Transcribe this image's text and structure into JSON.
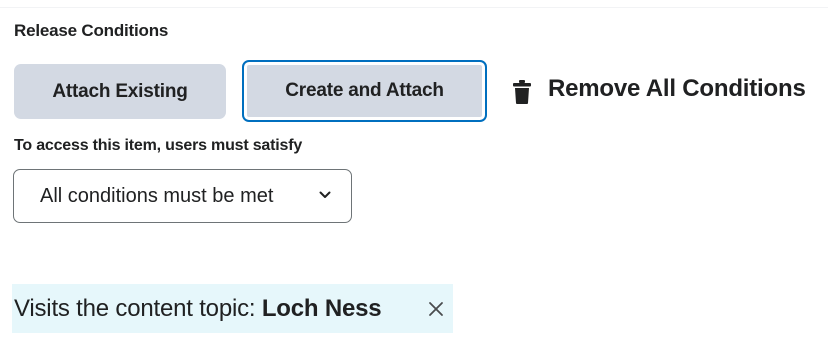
{
  "release_conditions": {
    "heading": "Release Conditions",
    "attach_existing_label": "Attach Existing",
    "create_and_attach_label": "Create and Attach",
    "remove_all_label": "Remove All Conditions",
    "access_label": "To access this item, users must satisfy",
    "criteria_select": {
      "selected_value": "All conditions must be met"
    },
    "conditions": [
      {
        "prefix": "Visits the content topic: ",
        "topic": "Loch Ness"
      }
    ]
  },
  "colors": {
    "button_bg": "#d3d9e3",
    "focus_border": "#006fbf",
    "condition_bg": "#e6f7fb",
    "text": "#202122"
  },
  "icons": [
    "trash-icon",
    "chevron-down-icon",
    "close-icon"
  ]
}
